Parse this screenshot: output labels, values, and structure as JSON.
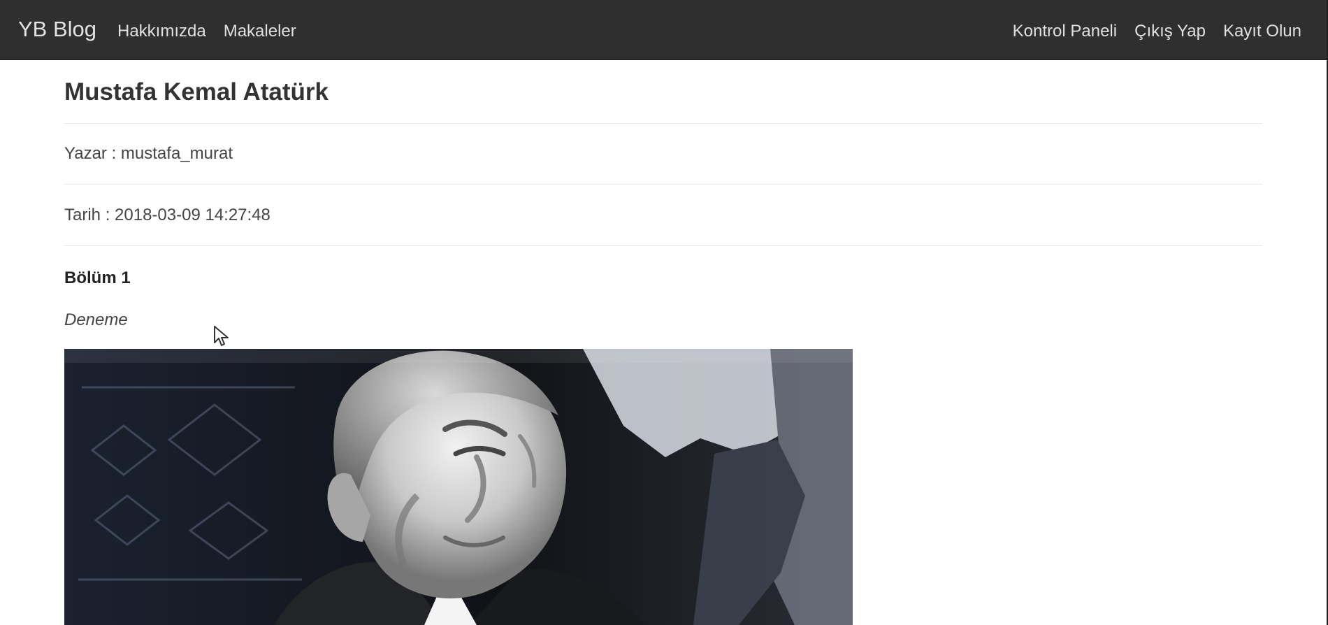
{
  "navbar": {
    "brand": "YB Blog",
    "left_links": [
      {
        "label": "Hakkımızda"
      },
      {
        "label": "Makaleler"
      }
    ],
    "right_links": [
      {
        "label": "Kontrol Paneli"
      },
      {
        "label": "Çıkış Yap"
      },
      {
        "label": "Kayıt Olun"
      }
    ]
  },
  "article": {
    "title": "Mustafa Kemal Atatürk",
    "author_line": "Yazar : mustafa_murat",
    "date_line": "Tarih : 2018-03-09 14:27:48",
    "section_heading": "Bölüm 1",
    "italic_text": "Deneme"
  },
  "image": {
    "icon": "portrait-photo"
  }
}
